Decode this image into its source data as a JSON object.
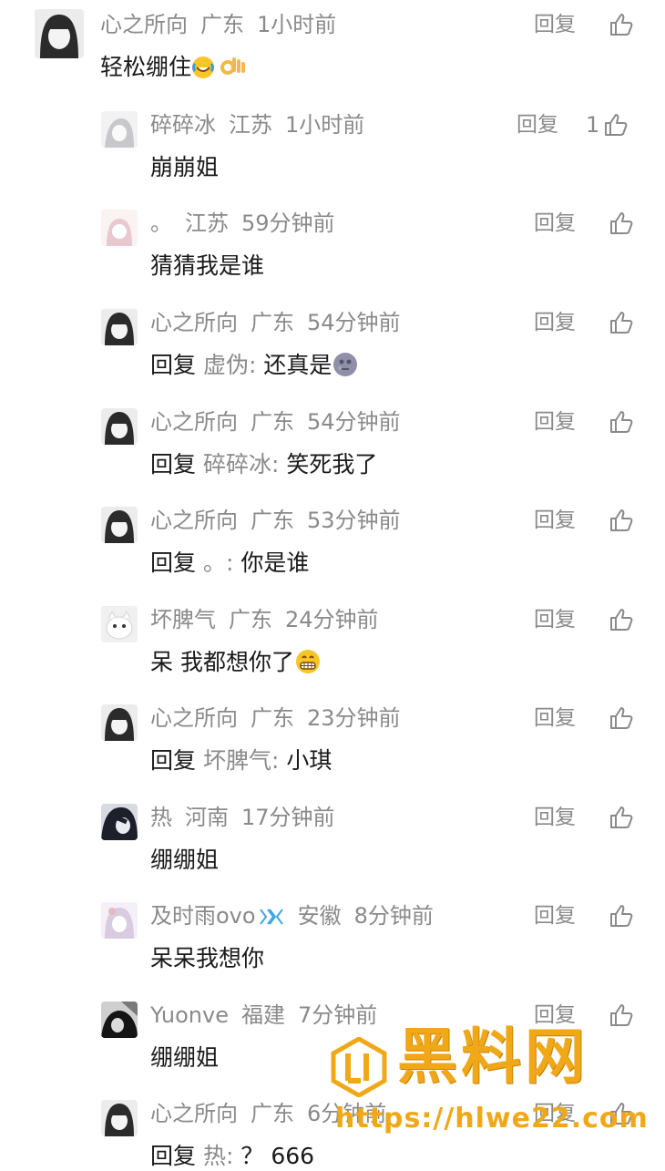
{
  "comments": [
    {
      "user": "心之所向",
      "region": "广东",
      "time": "1小时前",
      "text": "轻松绷住",
      "emoji": [
        "laugh-cry",
        "ok-hand"
      ],
      "likes": ""
    },
    {
      "user": "碎碎冰",
      "region": "江苏",
      "time": "1小时前",
      "text": "崩崩姐",
      "likes": "1"
    },
    {
      "user": "。",
      "region": "江苏",
      "time": "59分钟前",
      "text": "猜猜我是谁",
      "likes": ""
    },
    {
      "user": "心之所向",
      "region": "广东",
      "time": "54分钟前",
      "reply_prefix": "回复",
      "reply_to": "虚伪",
      "sep": ":",
      "text": "还真是",
      "emoji": [
        "moon-face"
      ],
      "likes": ""
    },
    {
      "user": "心之所向",
      "region": "广东",
      "time": "54分钟前",
      "reply_prefix": "回复",
      "reply_to": "碎碎冰",
      "sep": ":",
      "text": "笑死我了",
      "likes": ""
    },
    {
      "user": "心之所向",
      "region": "广东",
      "time": "53分钟前",
      "reply_prefix": "回复",
      "reply_to": "。",
      "sep": ":",
      "text": "你是谁",
      "likes": ""
    },
    {
      "user": "坏脾气",
      "region": "广东",
      "time": "24分钟前",
      "text": "呆 我都想你了",
      "emoji": [
        "grin-face"
      ],
      "likes": ""
    },
    {
      "user": "心之所向",
      "region": "广东",
      "time": "23分钟前",
      "reply_prefix": "回复",
      "reply_to": "坏脾气",
      "sep": ":",
      "text": "小琪",
      "likes": ""
    },
    {
      "user": "热",
      "region": "河南",
      "time": "17分钟前",
      "text": "绷绷姐",
      "likes": ""
    },
    {
      "user": "及时雨ovo",
      "region": "安徽",
      "time": "8分钟前",
      "text": "呆呆我想你",
      "vip": true,
      "likes": ""
    },
    {
      "user": "Yuonve",
      "region": "福建",
      "time": "7分钟前",
      "text": "绷绷姐",
      "likes": ""
    },
    {
      "user": "心之所向",
      "region": "广东",
      "time": "6分钟前",
      "reply_prefix": "回复",
      "reply_to": "热",
      "sep": ":",
      "text": "？ 666",
      "likes": ""
    }
  ],
  "reply_label": "回复",
  "watermark": {
    "title": "黑料网",
    "url": "https://hlwe22.com"
  },
  "colors": {
    "meta": "#8a8a8a",
    "text": "#1a1a1a",
    "watermark": "#f0a818",
    "vip": "#3fa7e6"
  }
}
